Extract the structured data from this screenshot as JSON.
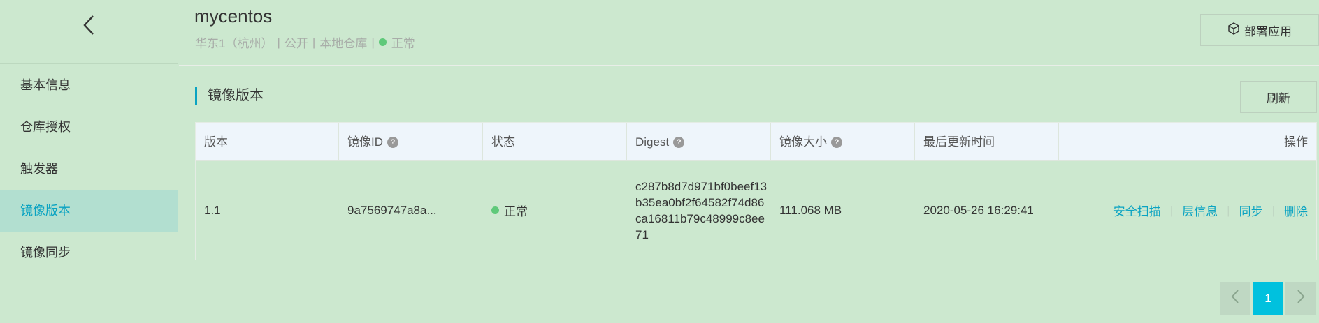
{
  "sidebar": {
    "back_icon": "chevron-left-icon",
    "items": [
      {
        "label": "基本信息",
        "active": false
      },
      {
        "label": "仓库授权",
        "active": false
      },
      {
        "label": "触发器",
        "active": false
      },
      {
        "label": "镜像版本",
        "active": true
      },
      {
        "label": "镜像同步",
        "active": false
      }
    ]
  },
  "header": {
    "repo_name": "mycentos",
    "region": "华东1（杭州）",
    "visibility": "公开",
    "repo_type": "本地仓库",
    "status": "正常",
    "status_color": "#5fc97a",
    "deploy_label": "部署应用",
    "deploy_icon": "cube-icon"
  },
  "section": {
    "title": "镜像版本",
    "refresh_label": "刷新",
    "accent_color": "#0aa3c2"
  },
  "table": {
    "columns": [
      "版本",
      "镜像ID",
      "状态",
      "Digest",
      "镜像大小",
      "最后更新时间",
      "操作"
    ],
    "help_mark": "?",
    "rows": [
      {
        "version": "1.1",
        "image_id": "9a7569747a8a...",
        "status": "正常",
        "digest": "c287b8d7d971bf0beef13b35ea0bf2f64582f74d86ca16811b79c48999c8ee71",
        "size": "111.068 MB",
        "updated": "2020-05-26 16:29:41",
        "actions": [
          "安全扫描",
          "层信息",
          "同步",
          "删除"
        ]
      }
    ]
  },
  "pagination": {
    "current": "1",
    "prev_icon": "chevron-left-icon",
    "next_icon": "chevron-right-icon"
  }
}
